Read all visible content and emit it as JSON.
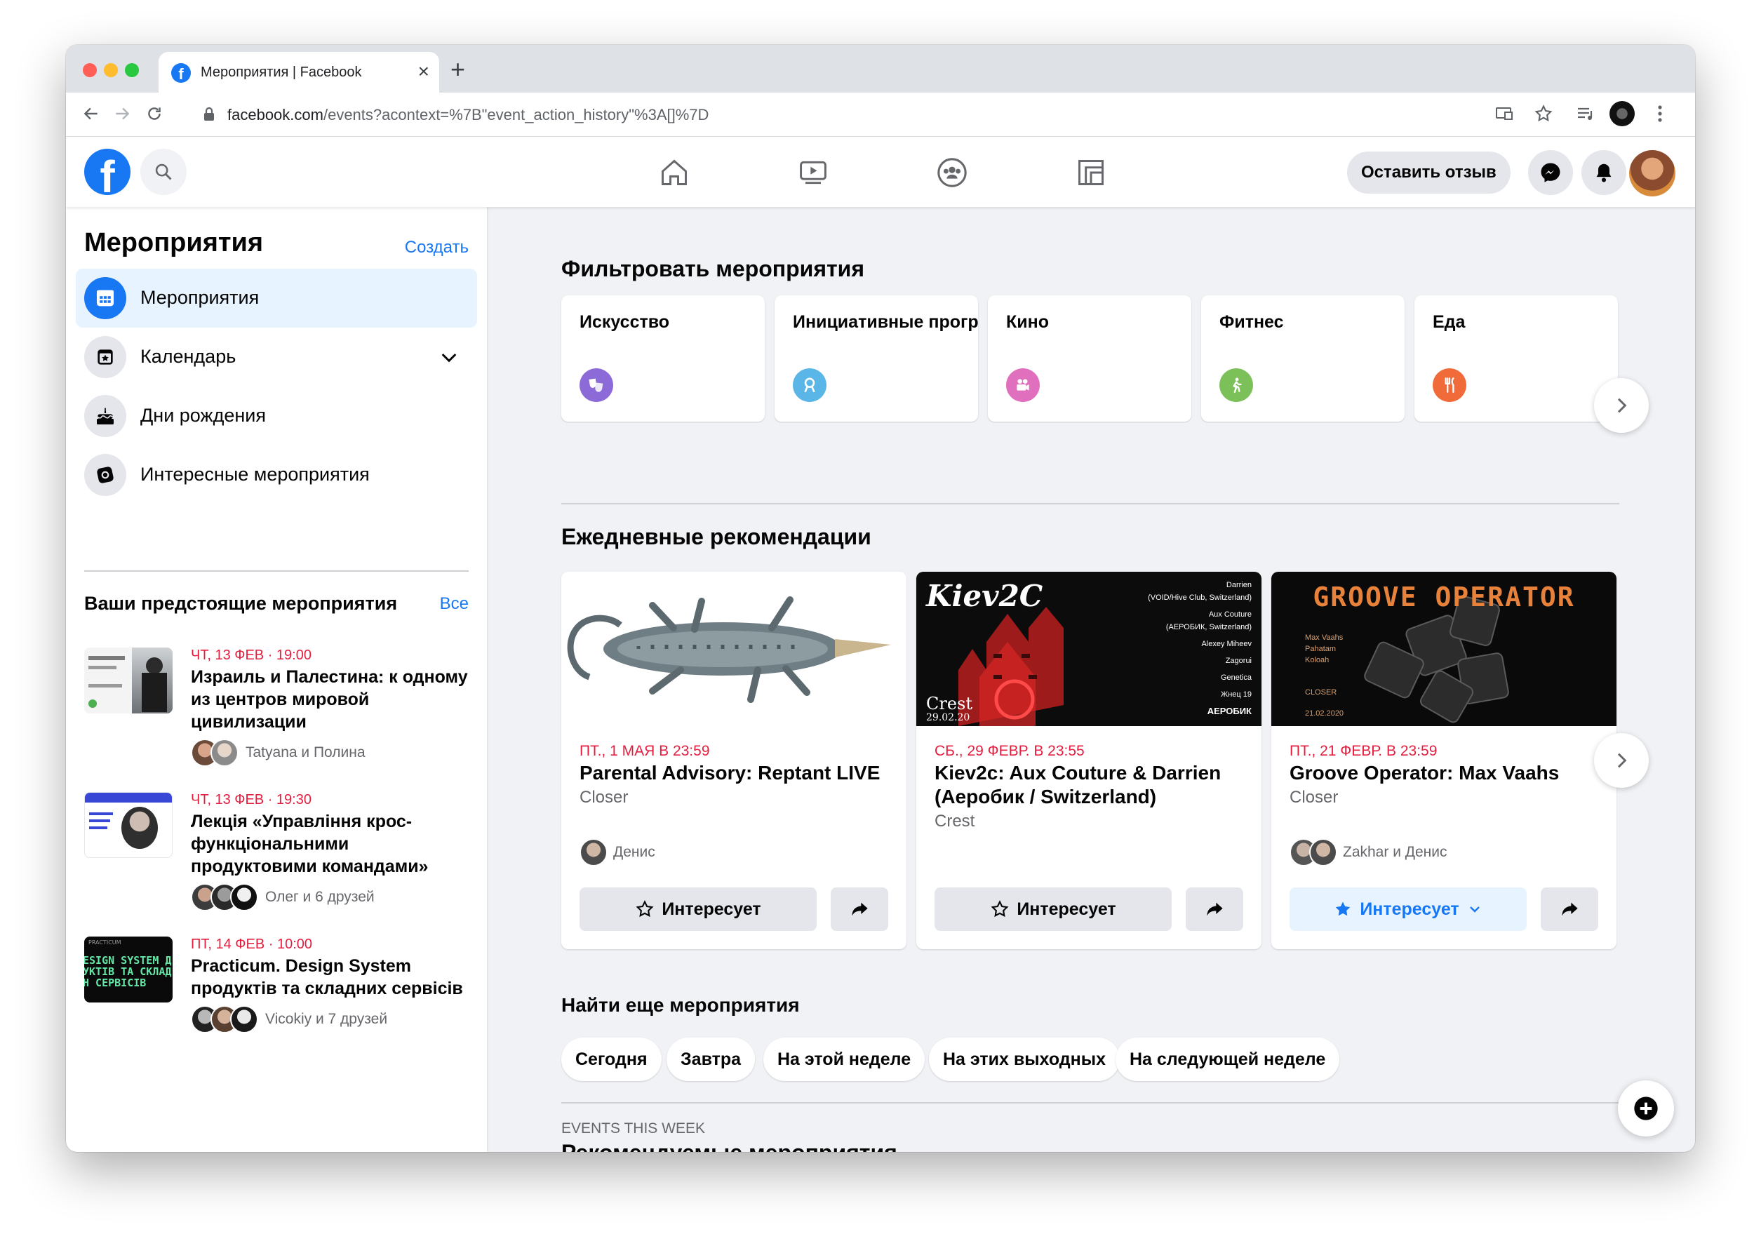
{
  "browser": {
    "tab_title": "Мероприятия | Facebook",
    "url_host": "facebook.com",
    "url_path": "/events?acontext=%7B\"event_action_history\"%3A[]%7D"
  },
  "topnav": {
    "logo": "f",
    "feedback_label": "Оставить отзыв"
  },
  "sidebar": {
    "title": "Мероприятия",
    "create_label": "Создать",
    "items": [
      {
        "label": "Мероприятия",
        "icon": "calendar-grid-icon",
        "active": true
      },
      {
        "label": "Календарь",
        "icon": "calendar-star-icon"
      },
      {
        "label": "Дни рождения",
        "icon": "cake-icon"
      },
      {
        "label": "Интересные мероприятия",
        "icon": "ticket-icon"
      }
    ],
    "upcoming_title": "Ваши предстоящие мероприятия",
    "upcoming_all": "Все",
    "upcoming": [
      {
        "date": "ЧТ, 13 ФЕВ · 19:00",
        "title": "Израиль и Палестина: к одному из центров мировой цивилизации",
        "friends": "Tatyana и Полина"
      },
      {
        "date": "ЧТ, 13 ФЕВ · 19:30",
        "title": "Лекція «Управління крос-функціональними продуктовими командами»",
        "friends": "Олег и 6 друзей"
      },
      {
        "date": "ПТ, 14 ФЕВ · 10:00",
        "title": "Practicum. Design System продуктів та складних сервісів",
        "friends": "Vicokiy и 7 друзей",
        "thumb_text": "ESIGN SYSTEM ДУКТІВ ТА СКЛАДН СЕРВІСІВ",
        "thumb_label": "PRACTICUM"
      }
    ]
  },
  "filter": {
    "title": "Фильтровать мероприятия",
    "categories": [
      {
        "name": "Искусство",
        "color": "#8c6ad7",
        "icon": "theater-masks-icon"
      },
      {
        "name": "Инициативные программы",
        "color": "#5bb6e8",
        "icon": "ribbon-icon"
      },
      {
        "name": "Кино",
        "color": "#e06fbd",
        "icon": "film-camera-icon"
      },
      {
        "name": "Фитнес",
        "color": "#7cc05a",
        "icon": "runner-icon"
      },
      {
        "name": "Еда",
        "color": "#f06a3a",
        "icon": "fork-knife-icon"
      }
    ]
  },
  "daily": {
    "title": "Ежедневные рекомендации",
    "interested_label": "Интересует",
    "cards": [
      {
        "date": "ПТ., 1 МАЯ В 23:59",
        "title": "Parental Advisory: Reptant LIVE",
        "place": "Closer",
        "friends": "Денис",
        "interested": false
      },
      {
        "date": "СБ., 29 ФЕВР. В 23:55",
        "title": "Kiev2c: Aux Couture & Darrien (Аеробик / Switzerland)",
        "place": "Crest",
        "friends": "",
        "interested": false,
        "poster_title": "Kiev2C",
        "poster_lines": [
          "Darrien",
          "(VOID/Hive Club, Switzerland)",
          "Aux Couture",
          "(АЕРОБИК, Switzerland)",
          "Alexey Miheev",
          "Zagorui",
          "Genetica",
          "Жнец 19",
          "АЕРОБИК"
        ],
        "poster_crest": "Crest",
        "poster_date": "29.02.20"
      },
      {
        "date": "ПТ., 21 ФЕВР. В 23:59",
        "title": "Groove Operator: Max Vaahs",
        "place": "Closer",
        "friends": "Zakhar и Денис",
        "interested": true,
        "poster_title": "GROOVE OPERATOR",
        "poster_lines": [
          "Max Vaahs",
          "Pahatam",
          "Koloah",
          "CLOSER",
          "21.02.2020"
        ]
      }
    ]
  },
  "find_more": {
    "title": "Найти еще мероприятия",
    "chips": [
      "Сегодня",
      "Завтра",
      "На этой неделе",
      "На этих выходных",
      "На следующей неделе"
    ]
  },
  "recommended": {
    "kicker": "EVENTS THIS WEEK",
    "title": "Рекомендуемые мероприятия"
  }
}
